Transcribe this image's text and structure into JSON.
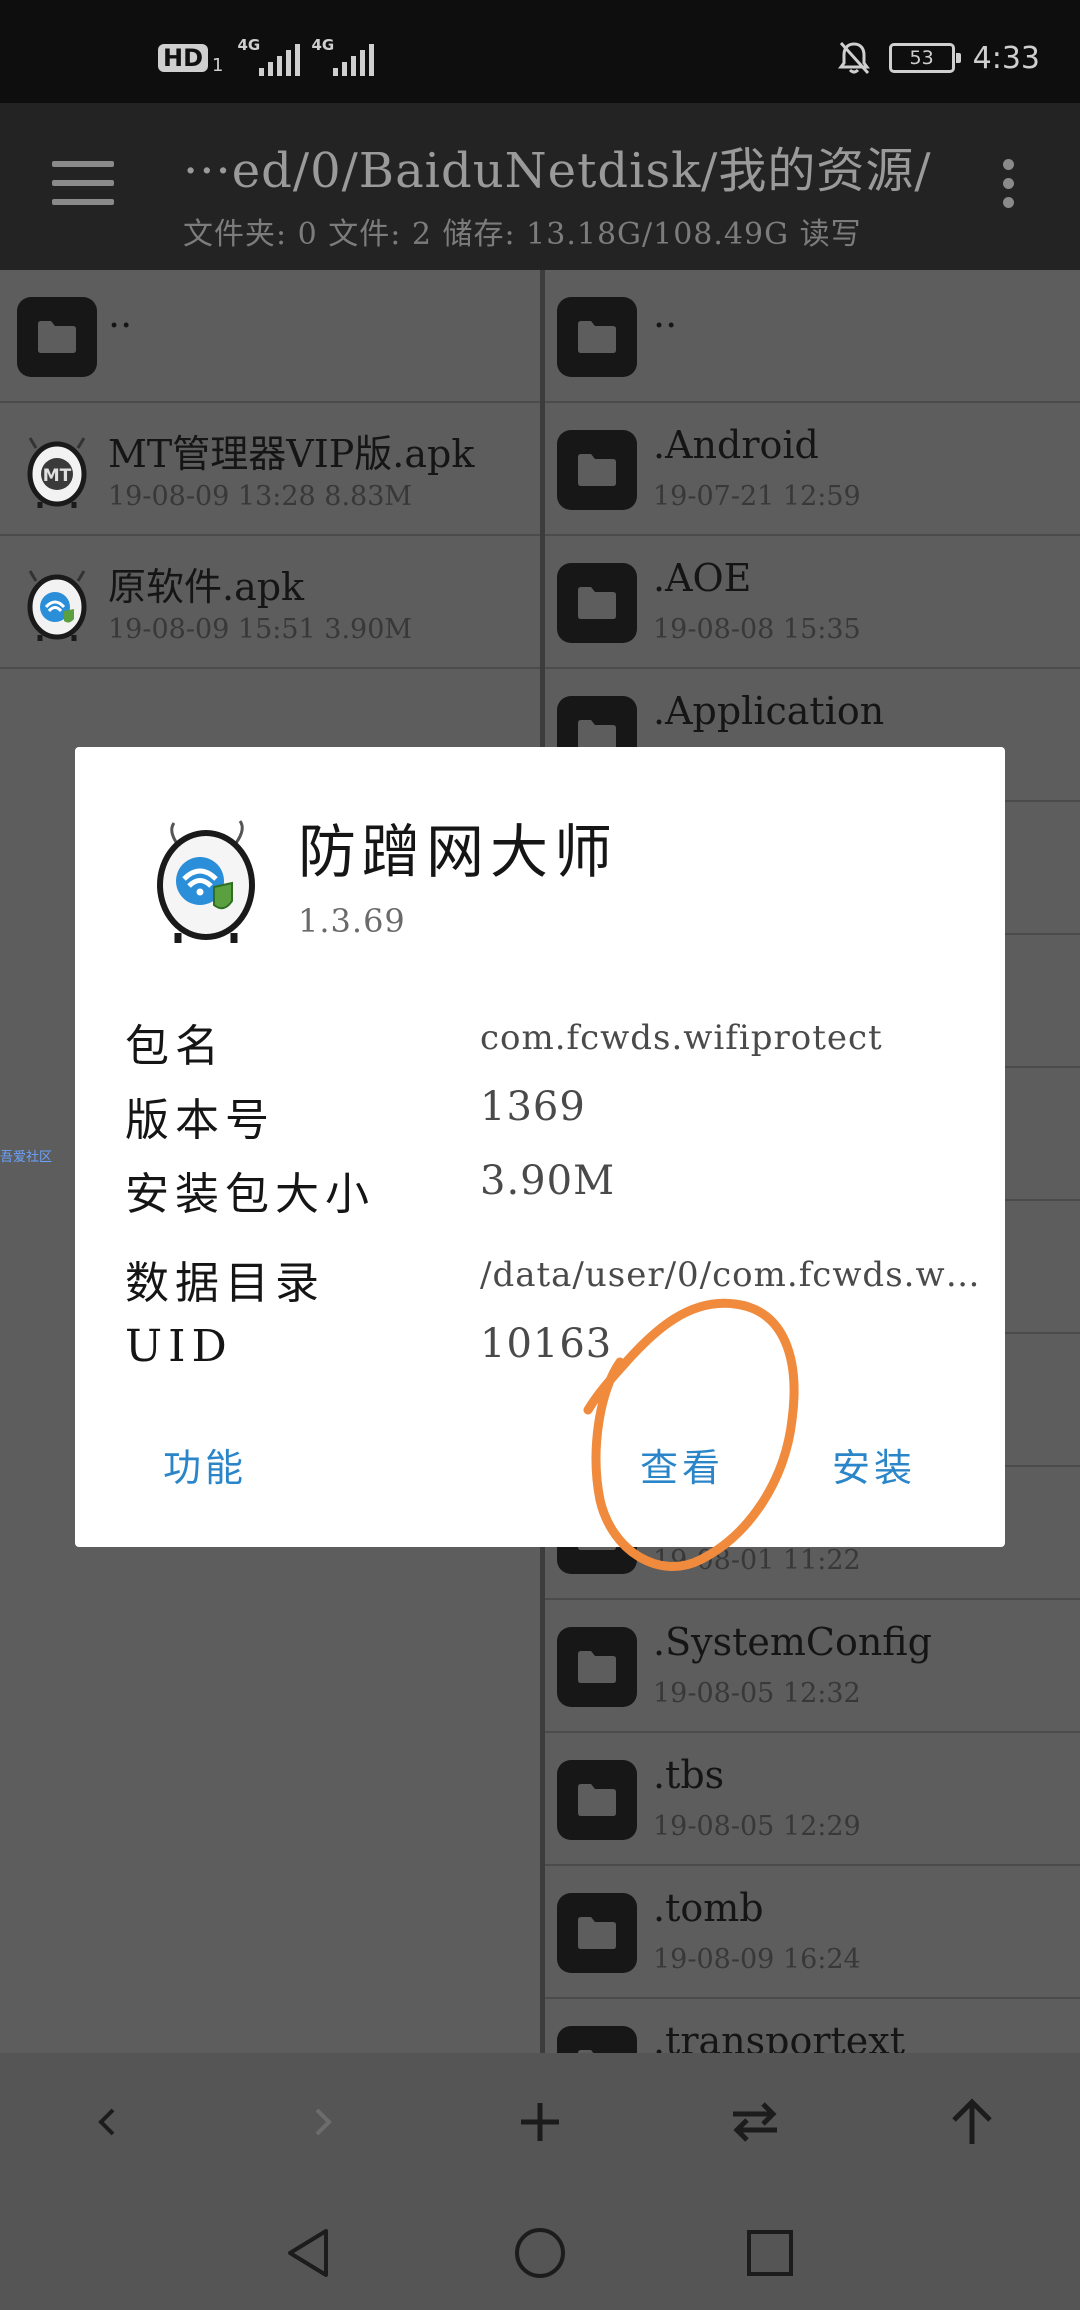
{
  "status_bar": {
    "hd_label": "HD",
    "hd_sub": "1",
    "signal1_label": "4G",
    "signal2_label": "4G",
    "battery_level": "53",
    "time": "4:33",
    "icons": [
      "hd-icon",
      "signal-icon",
      "signal-icon",
      "bell-off-icon",
      "battery-icon"
    ]
  },
  "app_bar": {
    "path": "···ed/0/BaiduNetdisk/我的资源/",
    "summary": "文件夹: 0  文件: 2  储存: 13.18G/108.49G  读写",
    "icons": [
      "menu-icon",
      "more-vert-icon"
    ]
  },
  "left_pane": {
    "parent": "..",
    "items": [
      {
        "name": "MT管理器VIP版.apk",
        "meta": "19-08-09 13:28  8.83M"
      },
      {
        "name": "原软件.apk",
        "meta": "19-08-09 15:51  3.90M"
      }
    ]
  },
  "right_pane": {
    "parent": "..",
    "items": [
      {
        "name": ".Android",
        "meta": "19-07-21 12:59"
      },
      {
        "name": ".AOE",
        "meta": "19-08-08 15:35"
      },
      {
        "name": ".Application",
        "meta": ""
      },
      {
        "name": "",
        "meta": ""
      },
      {
        "name": "",
        "meta": ""
      },
      {
        "name": "",
        "meta": ""
      },
      {
        "name": "",
        "meta": ""
      },
      {
        "name": "",
        "meta": ""
      },
      {
        "name": "",
        "meta": "19-08-01 11:22"
      },
      {
        "name": ".SystemConfig",
        "meta": "19-08-05 12:32"
      },
      {
        "name": ".tbs",
        "meta": "19-08-05 12:29"
      },
      {
        "name": ".tomb",
        "meta": "19-08-09 16:24"
      },
      {
        "name": ".transportext",
        "meta": ""
      }
    ]
  },
  "side_tag": "吾爱社区",
  "dialog": {
    "app_name": "防蹭网大师",
    "version": "1.3.69",
    "rows": [
      {
        "label": "包名",
        "value": "com.fcwds.wifiprotect"
      },
      {
        "label": "版本号",
        "value": "1369"
      },
      {
        "label": "安装包大小",
        "value": "3.90M"
      },
      {
        "label": "数据目录",
        "value": "/data/user/0/com.fcwds.wifi···"
      },
      {
        "label": "UID",
        "value": "10163"
      }
    ],
    "buttons": {
      "function": "功能",
      "view": "查看",
      "install": "安装"
    }
  },
  "toolbar": {
    "icons": [
      "back-arrow-icon",
      "forward-arrow-icon",
      "add-icon",
      "swap-icon",
      "up-arrow-icon"
    ]
  },
  "nav_bar": {
    "icons": [
      "nav-back-icon",
      "nav-home-icon",
      "nav-recents-icon"
    ]
  },
  "colors": {
    "accent": "#2a86c8",
    "annotation": "#f08a3c",
    "scrim_background": "#5d5d5d"
  }
}
